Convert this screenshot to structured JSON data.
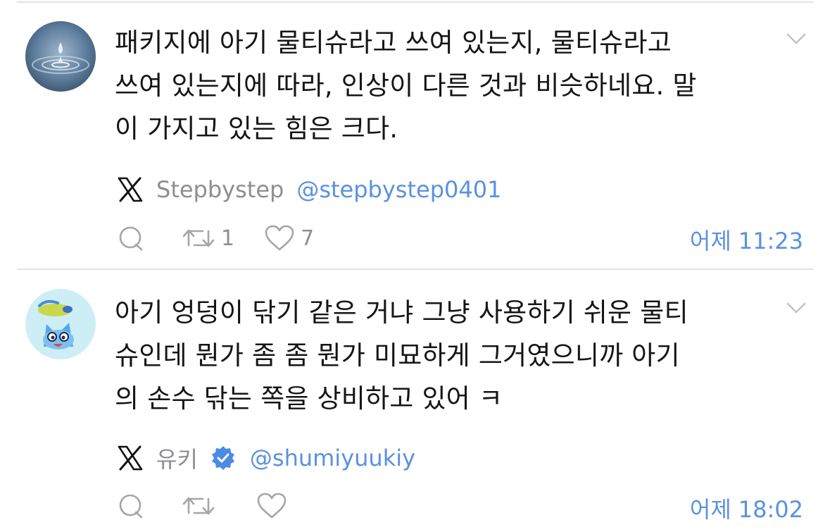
{
  "tweets": [
    {
      "avatar": "water-drop-avatar",
      "text": "패키지에 아기 물티슈라고 쓰여 있는지, 물티슈라고\n쓰여 있는지에 따라, 인상이 다른 것과 비슷하네요. 말\n이 가지고 있는 힘은 크다.",
      "author_name": "Stepbystep",
      "handle": "@stepbystep0401",
      "verified": false,
      "retweets": "1",
      "likes": "7",
      "day": "어제",
      "time": "11:23"
    },
    {
      "avatar": "cartoon-cat-avatar",
      "text": "아기 엉덩이 닦기 같은 거냐 그냥 사용하기 쉬운 물티\n슈인데 뭔가 좀 좀 뭔가 미묘하게 그거였으니까 아기\n의 손수 닦는 쪽을 상비하고 있어 ㅋ",
      "author_name": "유키",
      "handle": "@shumiyuukiy",
      "verified": true,
      "retweets": "",
      "likes": "",
      "day": "어제",
      "time": "18:02"
    }
  ],
  "icons": {
    "menu": "chevron-down-icon",
    "platform": "x-logo-icon",
    "reply": "reply-icon",
    "retweet": "retweet-icon",
    "like": "heart-icon",
    "verified": "verified-badge-icon"
  },
  "colors": {
    "link": "#5b91e0",
    "muted": "#8e8e93",
    "divider": "#e3e3e6",
    "verified": "#4c8be5"
  }
}
